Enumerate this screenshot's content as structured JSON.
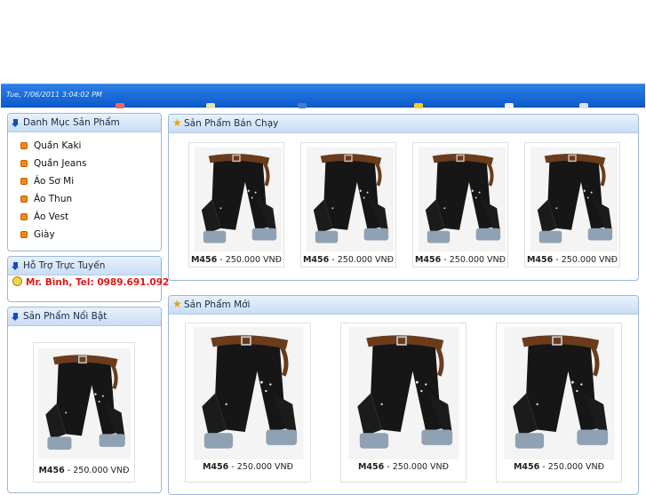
{
  "header": {
    "date": "Tue, 7/06/2011 3:04:02 PM"
  },
  "categories": {
    "title": "Danh Mục Sản Phẩm",
    "items": [
      "Quần Kaki",
      "Quần Jeans",
      "Áo Sơ Mi",
      "Áo Thun",
      "Áo Vest",
      "Giày"
    ]
  },
  "support": {
    "title": "Hỗ Trợ Trực Tuyến",
    "contact": "Mr. Bình, Tel: 0989.691.092"
  },
  "featured": {
    "title": "Sản Phẩm Nổi Bật",
    "product": {
      "code": "M456",
      "price": "- 250.000 VNĐ"
    }
  },
  "bestsellers": {
    "title": "Sản Phẩm Bán Chạy",
    "products": [
      {
        "code": "M456",
        "price": "- 250.000 VNĐ"
      },
      {
        "code": "M456",
        "price": "- 250.000 VNĐ"
      },
      {
        "code": "M456",
        "price": "- 250.000 VNĐ"
      },
      {
        "code": "M456",
        "price": "- 250.000 VNĐ"
      }
    ]
  },
  "new_products": {
    "title": "Sản Phẩm Mới",
    "products": [
      {
        "code": "M456",
        "price": "- 250.000 VNĐ"
      },
      {
        "code": "M456",
        "price": "- 250.000 VNĐ"
      },
      {
        "code": "M456",
        "price": "- 250.000 VNĐ"
      }
    ]
  }
}
